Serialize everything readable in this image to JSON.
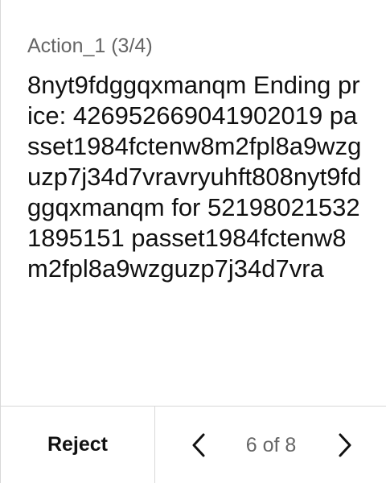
{
  "header": {
    "action_title": "Action_1 (3/4)"
  },
  "main": {
    "message": "8nyt9fdggqxmanqm Ending price: 426952669041902019 passet1984fctenw8m2fpl8a9wzguzp7j34d7vravryuhft808nyt9fdggqxmanqm for 521980215321895151 passet1984fctenw8m2fpl8a9wzguzp7j34d7vra"
  },
  "footer": {
    "reject_label": "Reject",
    "page_indicator": "6 of 8",
    "prev_icon": "chevron-left-icon",
    "next_icon": "chevron-right-icon"
  },
  "colors": {
    "primary_text": "#111111",
    "secondary_text": "#666666",
    "divider": "#d8d8d8",
    "background": "#ffffff"
  }
}
